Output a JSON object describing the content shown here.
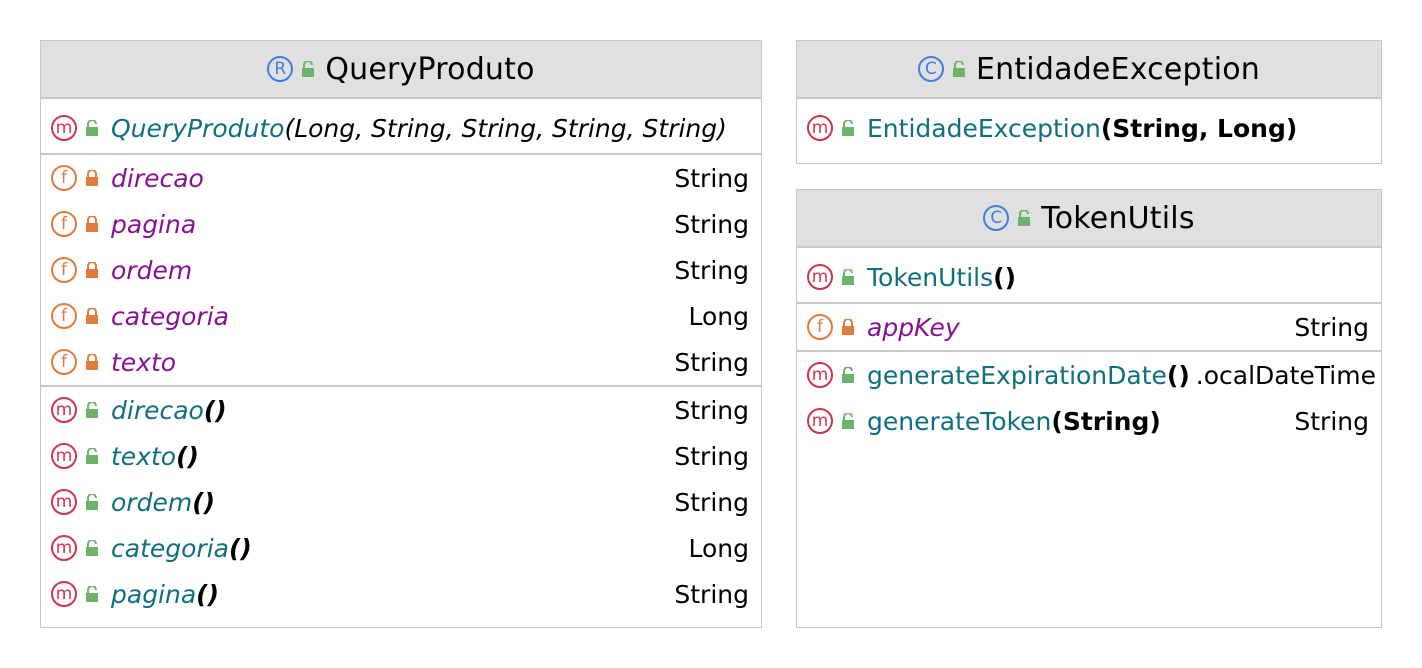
{
  "colors": {
    "header_bg": "#e0e0e0",
    "border": "#c6c6c6",
    "record_icon": "#3f7fe3",
    "method_icon": "#d3344d",
    "field_icon": "#e07b3c",
    "field_name": "#871094",
    "method_name": "#0f6f7f",
    "public_lock": "#6ab46a",
    "private_lock": "#e07b3c"
  },
  "boxes": {
    "query_produto": {
      "kind_icon": "R",
      "title": "QueryProduto",
      "constructor": {
        "icon": "m",
        "name": "QueryProduto",
        "params": " (Long, String, String, String, String)"
      },
      "fields": [
        {
          "icon": "f",
          "name": "direcao",
          "type": "String"
        },
        {
          "icon": "f",
          "name": "pagina",
          "type": "String"
        },
        {
          "icon": "f",
          "name": "ordem",
          "type": "String"
        },
        {
          "icon": "f",
          "name": "categoria",
          "type": "Long"
        },
        {
          "icon": "f",
          "name": "texto",
          "type": "String"
        }
      ],
      "methods": [
        {
          "icon": "m",
          "name": "direcao",
          "params": "()",
          "type": "String"
        },
        {
          "icon": "m",
          "name": "texto",
          "params": " ()",
          "type": "String"
        },
        {
          "icon": "m",
          "name": "ordem",
          "params": "()",
          "type": "String"
        },
        {
          "icon": "m",
          "name": "categoria",
          "params": "()",
          "type": "Long"
        },
        {
          "icon": "m",
          "name": "pagina",
          "params": "()",
          "type": "String"
        }
      ]
    },
    "entidade_exception": {
      "kind_icon": "C",
      "title": "EntidadeException",
      "constructor": {
        "icon": "m",
        "name": "EntidadeException",
        "params": " (String, Long)"
      }
    },
    "token_utils": {
      "kind_icon": "C",
      "title": "TokenUtils",
      "constructor": {
        "icon": "m",
        "name": "TokenUtils",
        "params": " ()"
      },
      "fields": [
        {
          "icon": "f",
          "name": "appKey",
          "type": "String"
        }
      ],
      "methods": [
        {
          "icon": "m",
          "name": "generateExpirationDate",
          "params": " ()",
          "type": ".ocalDateTime"
        },
        {
          "icon": "m",
          "name": "generateToken",
          "params": " (String)",
          "type": "String"
        }
      ]
    }
  }
}
